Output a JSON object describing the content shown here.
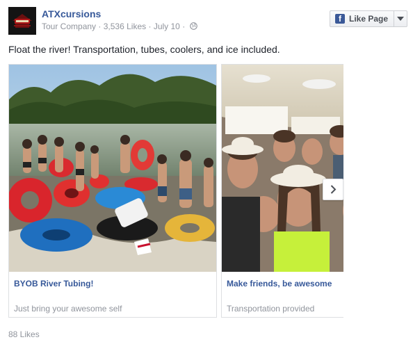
{
  "page": {
    "name": "ATXcursions",
    "category": "Tour Company",
    "likes_text": "3,536 Likes",
    "date": "July 10",
    "separator": "·"
  },
  "like_button": {
    "label": "Like Page",
    "icon": "facebook-f-icon"
  },
  "post": {
    "text": "Float the river! Transportation, tubes, coolers, and ice included."
  },
  "cards": [
    {
      "title": "BYOB River Tubing!",
      "subtitle": "Just bring your awesome self",
      "image": "group-of-people-with-inner-tubes-in-river-photo"
    },
    {
      "title": "Make friends, be awesome",
      "subtitle": "Transportation provided",
      "image": "group-selfie-inside-party-bus-photo"
    }
  ],
  "footer": {
    "likes": "88 Likes"
  },
  "colors": {
    "link_blue": "#365899",
    "muted_gray": "#90949c",
    "fb_blue": "#3b5998",
    "border": "#dddfe2"
  }
}
